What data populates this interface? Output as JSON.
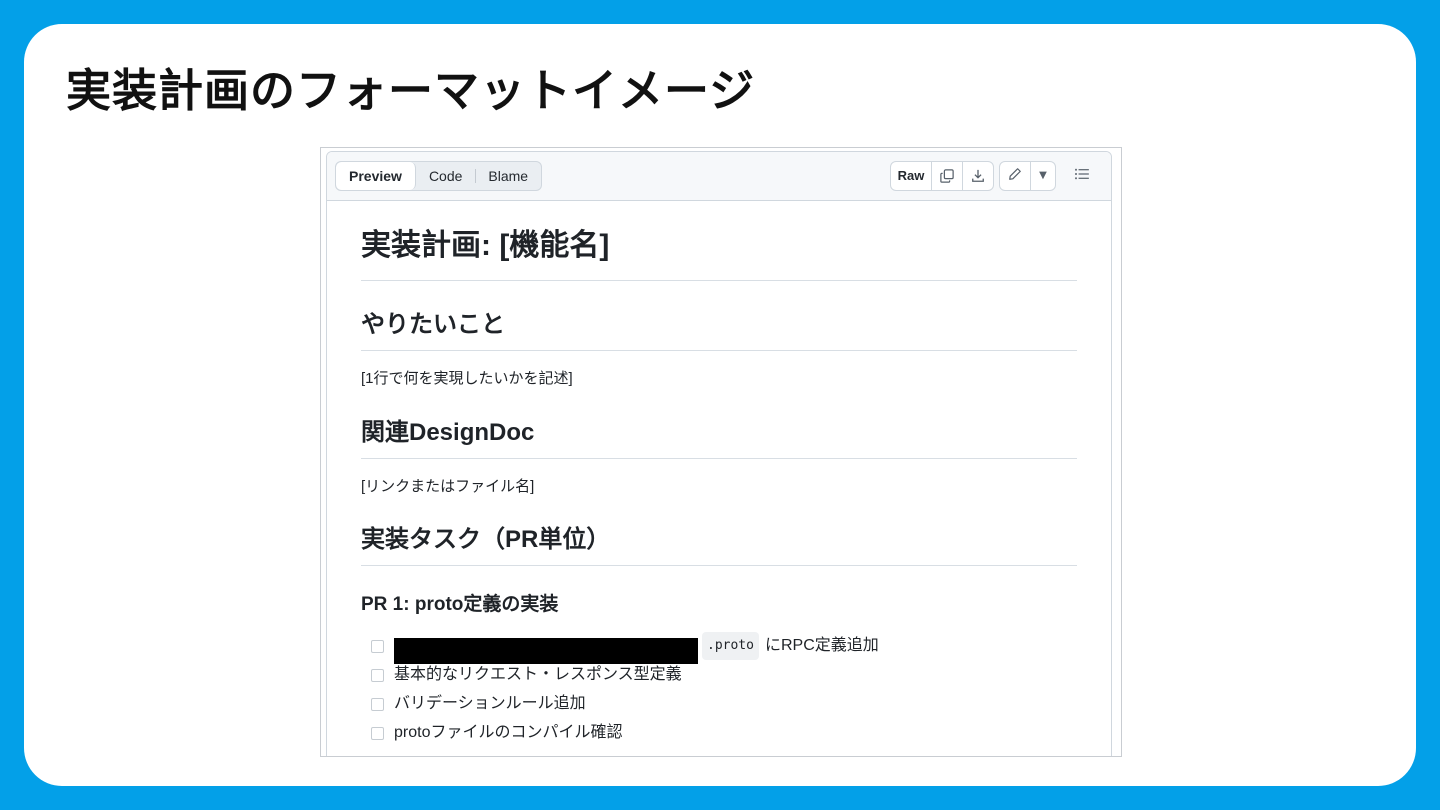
{
  "slide": {
    "title": "実装計画のフォーマットイメージ"
  },
  "toolbar": {
    "tabs": [
      {
        "label": "Preview",
        "active": true
      },
      {
        "label": "Code",
        "active": false
      },
      {
        "label": "Blame",
        "active": false
      }
    ],
    "raw_label": "Raw",
    "icons": [
      "copy-icon",
      "download-icon",
      "pencil-icon",
      "caret-down-icon",
      "list-icon"
    ]
  },
  "doc": {
    "h1": "実装計画: [機能名]",
    "section1": {
      "heading": "やりたいこと",
      "body": "[1行で何を実現したいかを記述]"
    },
    "section2": {
      "heading": "関連DesignDoc",
      "body": "[リンクまたはファイル名]"
    },
    "section3": {
      "heading": "実装タスク（PR単位）"
    },
    "pr1": {
      "heading": "PR 1: proto定義の実装",
      "tasks": [
        {
          "code": ".proto",
          "text": "にRPC定義追加",
          "redacted": true
        },
        {
          "text": "基本的なリクエスト・レスポンス型定義"
        },
        {
          "text": "バリデーションルール追加"
        },
        {
          "text": "protoファイルのコンパイル確認"
        }
      ]
    }
  },
  "colors": {
    "background": "#03a0e8",
    "card": "#ffffff",
    "toolbar_bg": "#f6f8fa",
    "border": "#d0d7de"
  }
}
